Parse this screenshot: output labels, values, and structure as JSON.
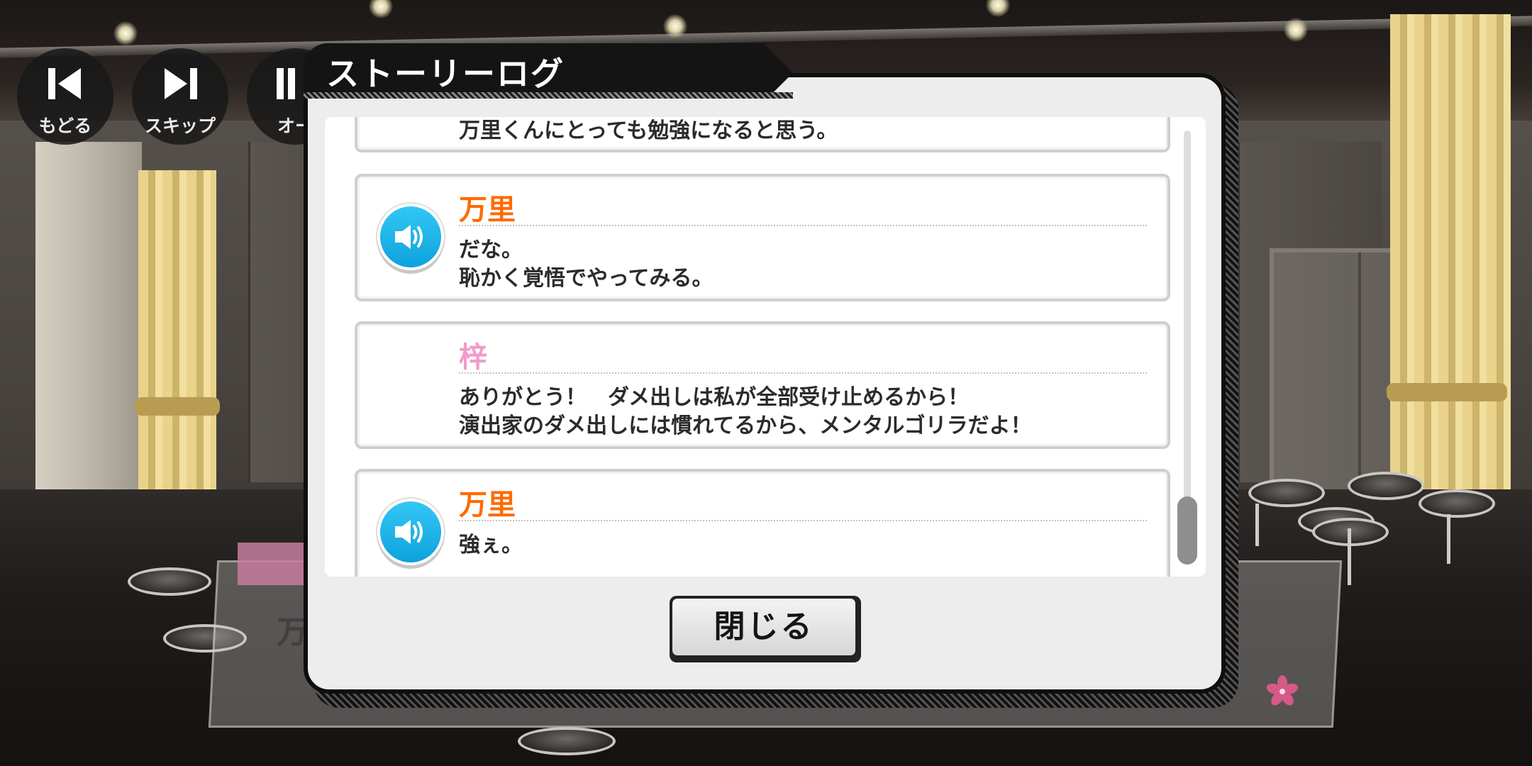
{
  "controls": {
    "back_label": "もどる",
    "skip_label": "スキップ",
    "auto_label": "オー"
  },
  "dialog": {
    "title": "ストーリーログ",
    "close_label": "閉じる"
  },
  "log_entries": [
    {
      "speaker": "",
      "lines": [
        "万里くんにとっても勉強になると思う。"
      ],
      "voice": false
    },
    {
      "speaker": "万里",
      "name_color": "#ff6a00",
      "lines": [
        "だな。",
        "恥かく覚悟でやってみる。"
      ],
      "voice": true
    },
    {
      "speaker": "梓",
      "name_color": "#f29ac9",
      "lines": [
        "ありがとう！　ダメ出しは私が全部受け止めるから！",
        "演出家のダメ出しには慣れてるから、メンタルゴリラだよ！"
      ],
      "voice": false
    },
    {
      "speaker": "万里",
      "name_color": "#ff6a00",
      "lines": [
        "強ぇ。"
      ],
      "voice": true
    }
  ],
  "background": {
    "message_name": "万"
  },
  "colors": {
    "speaker_button": "#1fb3ea",
    "name_banri": "#ff6a00",
    "name_azusa": "#f29ac9",
    "modal_bg": "#ededed"
  },
  "icons": {
    "back": "rewind-icon",
    "skip": "skip-forward-icon",
    "auto": "auto-play-icon",
    "voice": "speaker-icon",
    "decor": "sakura-icon"
  }
}
